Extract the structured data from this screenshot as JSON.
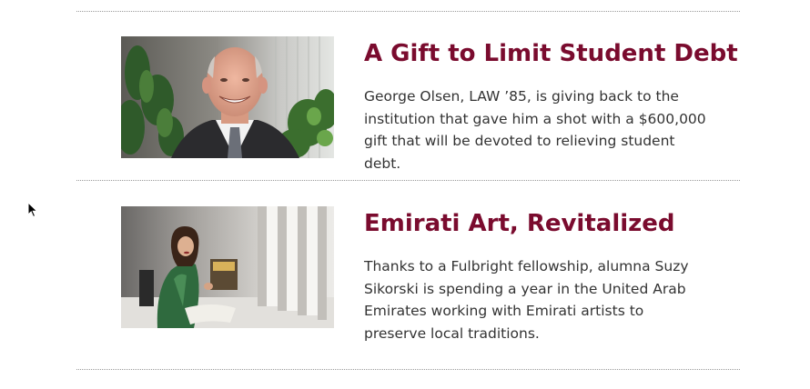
{
  "articles": [
    {
      "title": "A Gift to Limit Student Debt",
      "summary": "George Olsen, LAW ’85, is giving back to the institution that gave him a shot with a $600,000 gift that will be devoted to relieving student debt."
    },
    {
      "title": "Emirati Art, Revitalized",
      "summary": "Thanks to a Fulbright fellowship, alumna Suzy Sikorski is spending a year in the United Arab Emirates working with Emirati artists to preserve local traditions."
    }
  ],
  "colors": {
    "title": "#7a0b2e",
    "body_text": "#333333",
    "divider": "#9a9a9a"
  },
  "icons": {
    "cursor": "mouse-pointer-icon"
  }
}
